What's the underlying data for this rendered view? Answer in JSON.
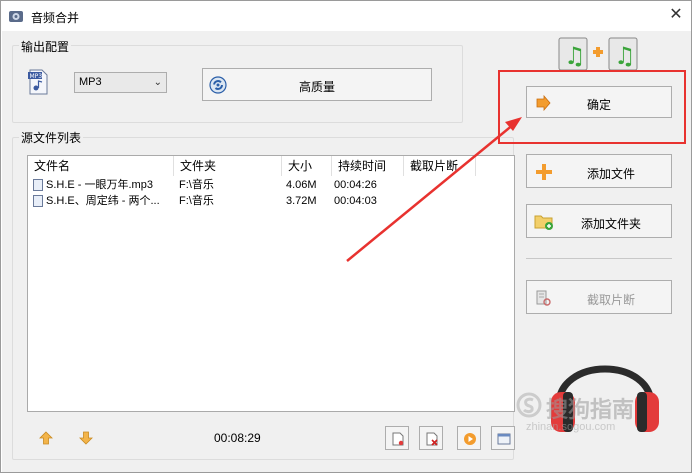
{
  "window": {
    "title": "音频合并",
    "close_glyph": "✕"
  },
  "output": {
    "group_label": "输出配置",
    "format": "MP3",
    "quality_label": "高质量"
  },
  "source": {
    "group_label": "源文件列表",
    "columns": [
      "文件名",
      "文件夹",
      "大小",
      "持续时间",
      "截取片断"
    ],
    "rows": [
      {
        "name": "S.H.E - 一眼万年.mp3",
        "folder": "F:\\音乐",
        "size": "4.06M",
        "duration": "00:04:26",
        "clip": ""
      },
      {
        "name": "S.H.E、周定纬 - 两个...",
        "folder": "F:\\音乐",
        "size": "3.72M",
        "duration": "00:04:03",
        "clip": ""
      }
    ],
    "total_time": "00:08:29"
  },
  "actions": {
    "confirm_label": "确定",
    "add_file_label": "添加文件",
    "add_folder_label": "添加文件夹",
    "clip_label": "截取片断"
  },
  "watermark": {
    "brand": "搜狗指南",
    "url": "zhinan.sogou.com"
  },
  "colors": {
    "annotation": "#e8322f",
    "orange": "#f39c2e",
    "headphone_red": "#e33b3b",
    "music_green": "#3aa43a"
  },
  "icons": {
    "app": "speaker-icon",
    "mp3": "mp3-file-icon",
    "quality": "disc-icon",
    "confirm": "arrow-right-icon",
    "add_file": "plus-icon",
    "add_folder": "folder-add-icon",
    "clip": "scissors-icon",
    "move_up": "arrow-up-icon",
    "move_down": "arrow-down-icon",
    "merge": "music-merge-icon",
    "headphones": "headphones-icon"
  }
}
